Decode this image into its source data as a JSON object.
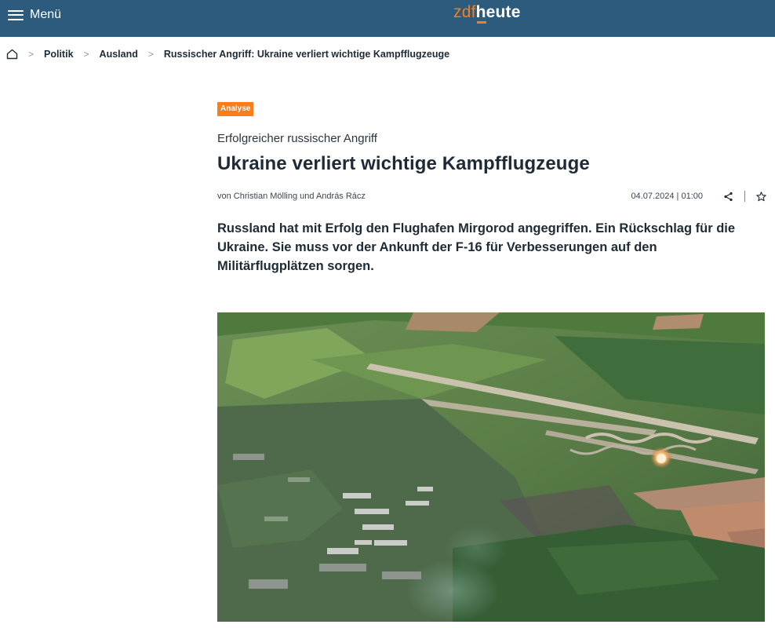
{
  "header": {
    "menu_label": "Menü",
    "logo_part1": "zdf",
    "logo_part2": "heute",
    "brand_color": "#2d5b7d",
    "accent_color": "#fa7d19"
  },
  "breadcrumb": {
    "items": [
      "Politik",
      "Ausland",
      "Russischer Angriff: Ukraine verliert wichtige Kampfflugzeuge"
    ]
  },
  "article": {
    "badge": "Analyse",
    "kicker": "Erfolgreicher russischer Angriff",
    "headline": "Ukraine verliert wichtige Kampfflugzeuge",
    "authors": "von Christian Mölling und András Rácz",
    "date": "04.07.2024 | 01:00",
    "lead": "Russland hat mit Erfolg den Flughafen Mirgorod angegriffen. Ein Rückschlag für die Ukraine. Sie muss vor der Ankunft der F-16 für Verbesserungen auf den Militärflugplätzen sorgen."
  },
  "icons": {
    "menu": "hamburger-icon",
    "home": "home-icon",
    "breadcrumb_separator": "chevron-right-icon",
    "share": "share-icon",
    "bookmark": "star-icon"
  }
}
